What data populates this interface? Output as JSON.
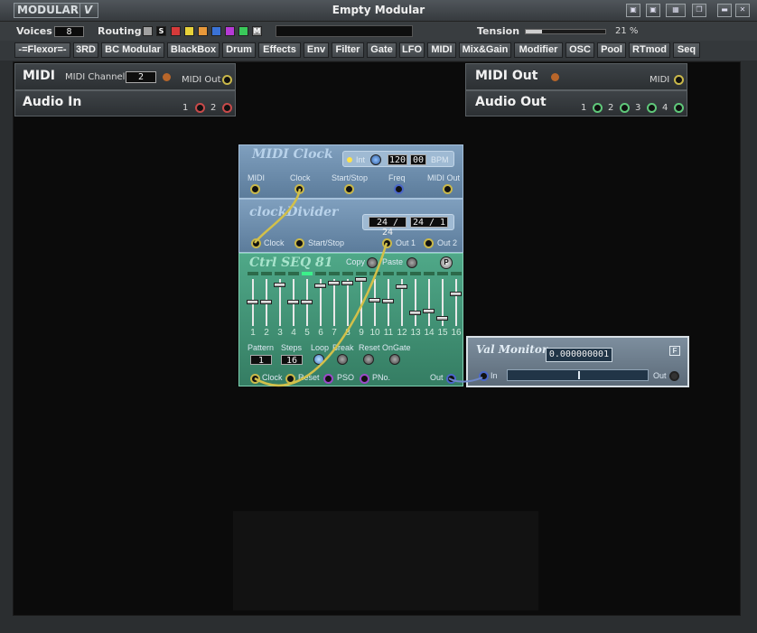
{
  "window": {
    "logo": "MODULAR",
    "logo_v": "V",
    "title": "Empty Modular"
  },
  "toolbar": {
    "voices_label": "Voices",
    "voices_value": "8",
    "routing_label": "Routing",
    "swatch_s": "S",
    "swatch_m": "M",
    "tension_label": "Tension",
    "tension_value": "21 %",
    "tension_fraction": 0.21
  },
  "categories": [
    "-=Flexor=-",
    "3RD",
    "BC Modular",
    "BlackBox",
    "Drum",
    "Effects",
    "Env",
    "Filter",
    "Gate",
    "LFO",
    "MIDI",
    "Mix&Gain",
    "Modifier",
    "OSC",
    "Pool",
    "RTmod",
    "Seq"
  ],
  "midi_in": {
    "title": "MIDI",
    "channel_label": "MIDI Channel",
    "channel_value": "2",
    "out_label": "MIDI Out"
  },
  "audio_in": {
    "title": "Audio In",
    "port1": "1",
    "port2": "2"
  },
  "midi_out": {
    "title": "MIDI Out",
    "midi_label": "MIDI"
  },
  "audio_out": {
    "title": "Audio Out",
    "ports": [
      "1",
      "2",
      "3",
      "4"
    ]
  },
  "midi_clock": {
    "title": "MIDI Clock",
    "int_label": "Int",
    "bpm_value": "120",
    "bpm_frac": "00",
    "bpm_label": "BPM",
    "ports": [
      "MIDI",
      "Clock",
      "Start/Stop",
      "Freq",
      "MIDI Out"
    ]
  },
  "clock_divider": {
    "title": "clockDivider",
    "div1": "24 / 24",
    "div2": "24 / 1",
    "ports": [
      "Clock",
      "Start/Stop",
      "Out 1",
      "Out 2"
    ]
  },
  "ctrl_seq": {
    "title": "Ctrl SEQ 81",
    "copy_label": "Copy",
    "paste_label": "Paste",
    "p_label": "P",
    "steps": [
      "1",
      "2",
      "3",
      "4",
      "5",
      "6",
      "7",
      "8",
      "9",
      "10",
      "11",
      "12",
      "13",
      "14",
      "15",
      "16"
    ],
    "pattern_label": "Pattern",
    "pattern_value": "1",
    "steps_label": "Steps",
    "steps_value": "16",
    "loop_label": "Loop",
    "break_label": "Break",
    "reset_label": "Reset",
    "ongate_label": "OnGate",
    "ports": [
      "Clock",
      "Reset",
      "PSO",
      "PNo."
    ],
    "out_label": "Out"
  },
  "val_monitor": {
    "title": "Val Monitor",
    "value": "0.000000001",
    "in_label": "In",
    "out_label": "Out",
    "f_label": "F"
  }
}
